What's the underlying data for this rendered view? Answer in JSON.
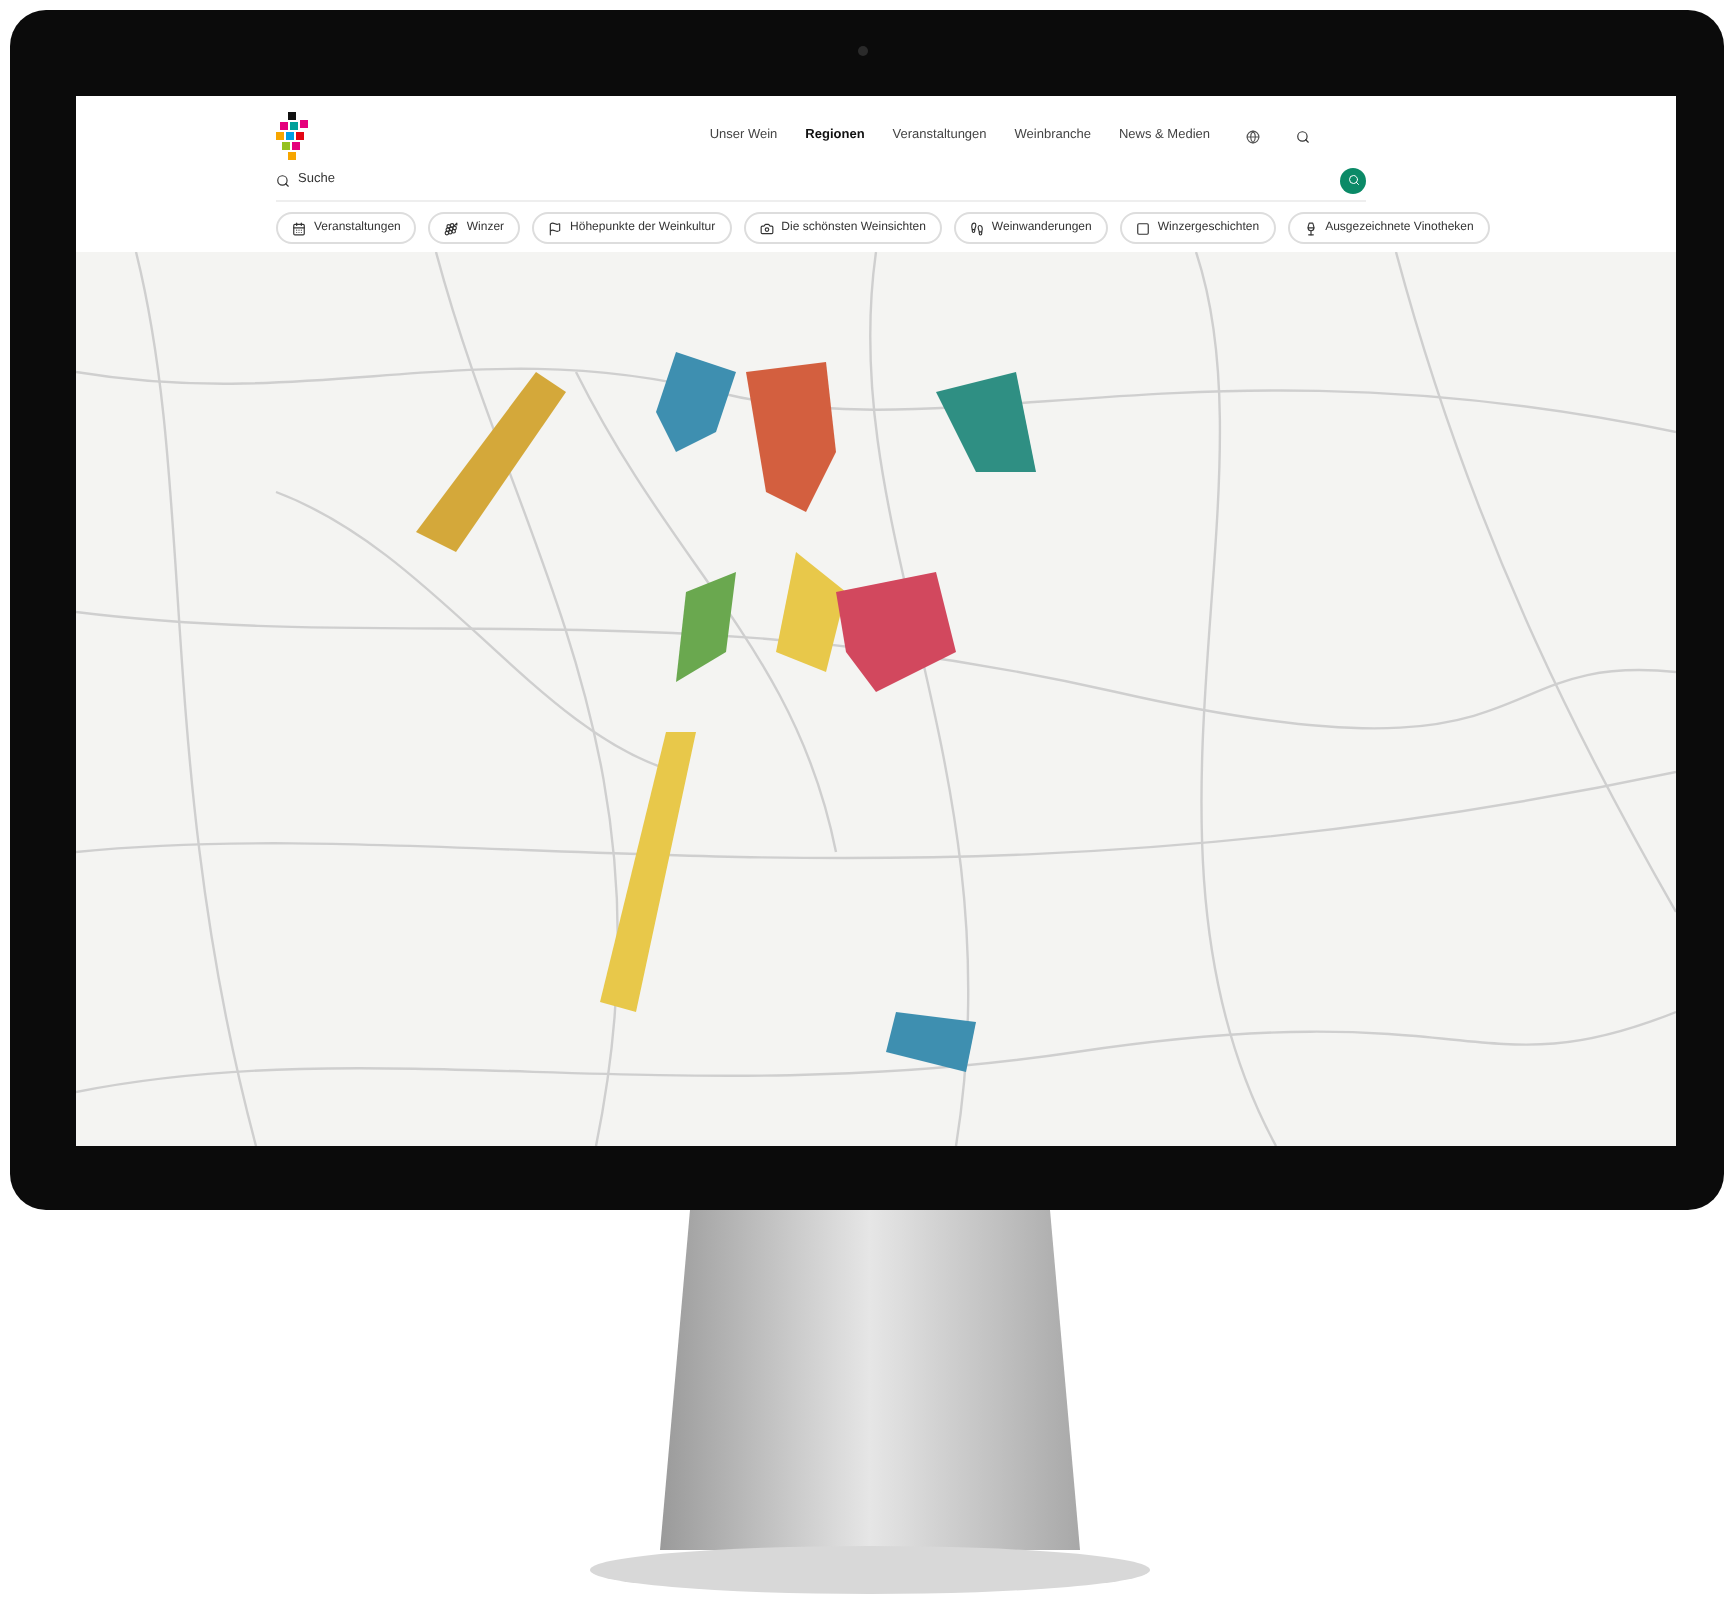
{
  "nav": {
    "items": [
      {
        "label": "Unser Wein",
        "selected": false
      },
      {
        "label": "Regionen",
        "selected": true
      },
      {
        "label": "Veranstaltungen",
        "selected": false
      },
      {
        "label": "Weinbranche",
        "selected": false
      },
      {
        "label": "News & Medien",
        "selected": false
      }
    ]
  },
  "search": {
    "placeholder": "Suche"
  },
  "filters": [
    {
      "label": "Veranstaltungen",
      "kind": "events"
    },
    {
      "label": "Winzer",
      "kind": "winemaker"
    },
    {
      "label": "Höhepunkte der Weinkultur",
      "kind": "highlights"
    },
    {
      "label": "Die schönsten Weinsichten",
      "kind": "views"
    },
    {
      "label": "Weinwanderungen",
      "kind": "hiking"
    },
    {
      "label": "Winzergeschichten",
      "kind": "stories"
    },
    {
      "label": "Ausgezeichnete Vinotheken",
      "kind": "vinotheque"
    }
  ]
}
